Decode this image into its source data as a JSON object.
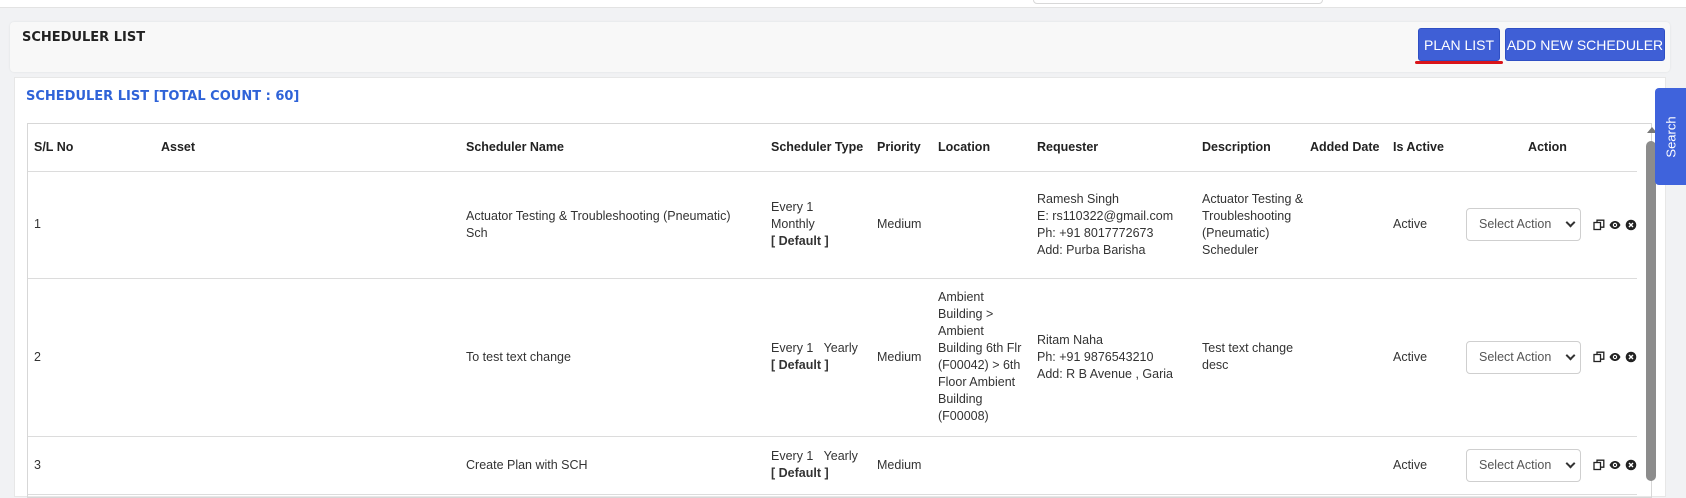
{
  "header": {
    "title": "SCHEDULER LIST",
    "plan_list_label": "PLAN LIST",
    "add_new_label": "ADD NEW SCHEDULER"
  },
  "panel": {
    "count_label": "SCHEDULER LIST [TOTAL COUNT : 60]"
  },
  "side_tab": {
    "label": "Search"
  },
  "table": {
    "columns": [
      "S/L No",
      "Asset",
      "Scheduler Name",
      "Scheduler Type",
      "Priority",
      "Location",
      "Requester",
      "Description",
      "Added Date",
      "Is Active",
      "Action"
    ],
    "select_placeholder": "Select Action",
    "rows": [
      {
        "sl": "1",
        "asset": "",
        "name": "Actuator Testing & Troubleshooting (Pneumatic) Sch",
        "type_line1": "Every 1",
        "type_line2": "Monthly",
        "type_default": "[ Default ]",
        "priority": "Medium",
        "location": "",
        "requester": [
          "Ramesh Singh",
          "E: rs110322@gmail.com",
          "Ph: +91 8017772673",
          "Add: Purba Barisha"
        ],
        "description": "Actuator Testing & Troubleshooting (Pneumatic) Scheduler",
        "added_date": "",
        "is_active": "Active"
      },
      {
        "sl": "2",
        "asset": "",
        "name": "To test text change",
        "type_line1": "Every 1   Yearly",
        "type_line2": "",
        "type_default": "[ Default ]",
        "priority": "Medium",
        "location": "Ambient Building > Ambient Building 6th Flr (F00042) > 6th Floor Ambient Building (F00008)",
        "requester": [
          "Ritam Naha",
          "Ph: +91 9876543210",
          "Add: R B Avenue , Garia"
        ],
        "description": "Test text change desc",
        "added_date": "",
        "is_active": "Active"
      },
      {
        "sl": "3",
        "asset": "",
        "name": "Create Plan with SCH",
        "type_line1": "Every 1   Yearly",
        "type_line2": "",
        "type_default": "[ Default ]",
        "priority": "Medium",
        "location": "",
        "requester": [],
        "description": "",
        "added_date": "",
        "is_active": "Active"
      }
    ]
  },
  "icons": {
    "copy": "copy-icon",
    "view": "eye-icon",
    "delete": "close-circle-icon"
  },
  "colors": {
    "primary_button": "#3f5fd6",
    "count_text": "#2f63d8",
    "underline": "#d9141a"
  }
}
